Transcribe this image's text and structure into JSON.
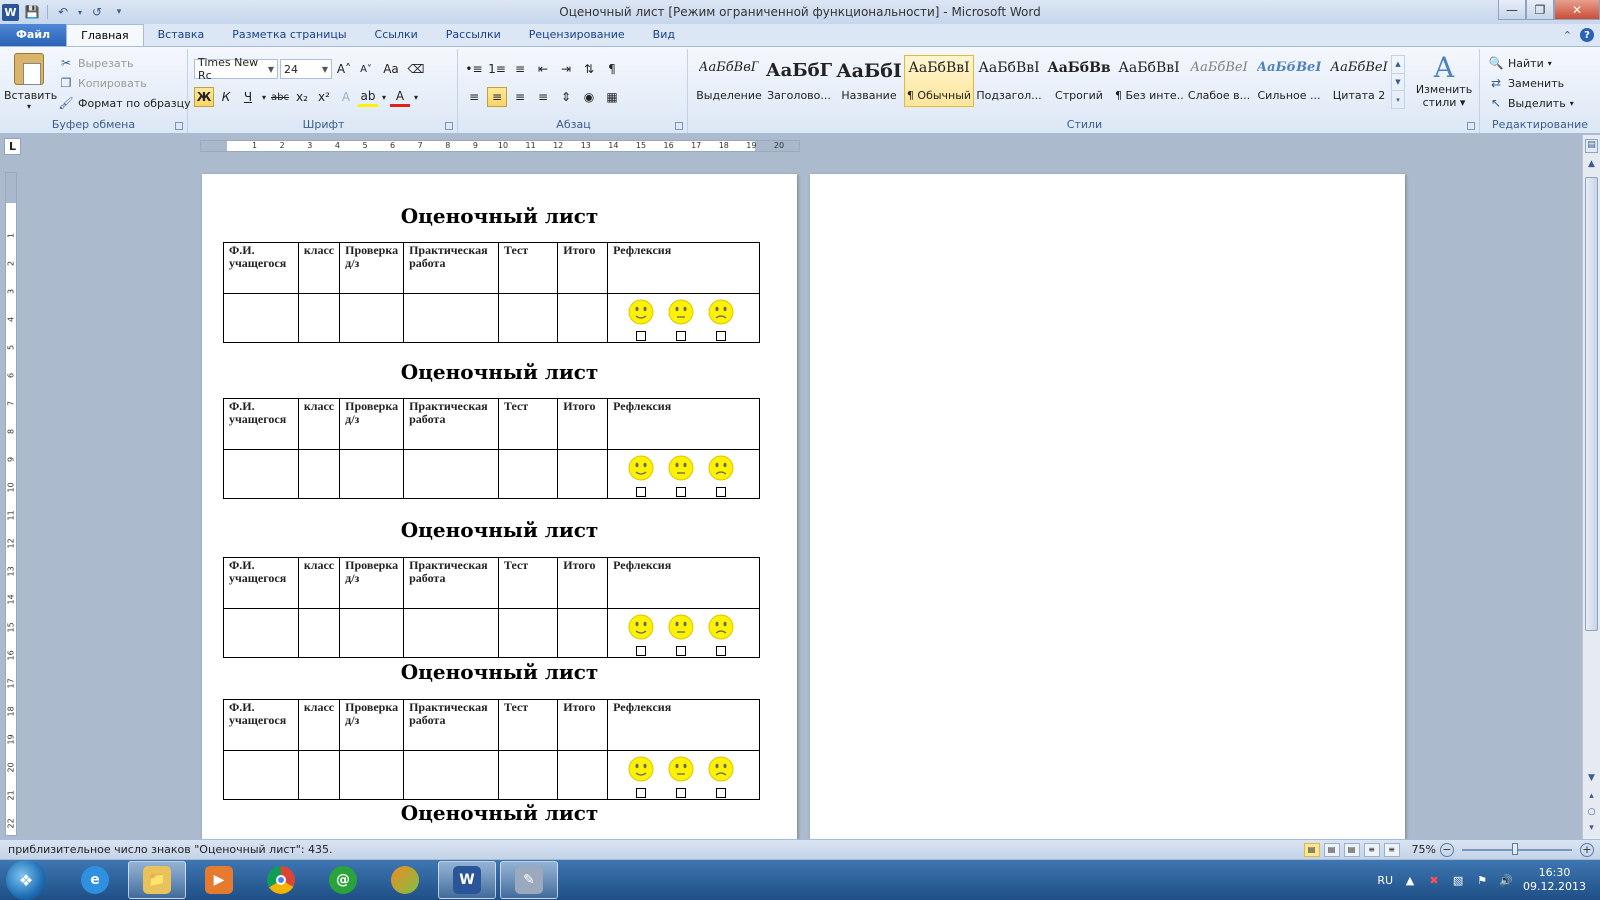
{
  "window": {
    "title": "Оценочный лист [Режим ограниченной функциональности]  -  Microsoft Word"
  },
  "tabs": [
    {
      "label": "Файл"
    },
    {
      "label": "Главная"
    },
    {
      "label": "Вставка"
    },
    {
      "label": "Разметка страницы"
    },
    {
      "label": "Ссылки"
    },
    {
      "label": "Рассылки"
    },
    {
      "label": "Рецензирование"
    },
    {
      "label": "Вид"
    }
  ],
  "clipboard": {
    "paste": "Вставить",
    "cut": "Вырезать",
    "copy": "Копировать",
    "format_painter": "Формат по образцу",
    "label": "Буфер обмена"
  },
  "font": {
    "name": "Times New Rc",
    "size": "24",
    "label": "Шрифт",
    "grow_icon": "A˄",
    "shrink_icon": "A˅",
    "case_icon": "Aa",
    "bold": "Ж",
    "italic": "К",
    "underline": "Ч",
    "strike": "abc",
    "subscript": "x₂",
    "superscript": "x²"
  },
  "paragraph": {
    "label": "Абзац",
    "pilcrow": "¶"
  },
  "styles": {
    "label": "Стили",
    "items": [
      {
        "sample": "АаБбВвГ",
        "name": "Выделение"
      },
      {
        "sample": "АаБбГ",
        "name": "Заголово..."
      },
      {
        "sample": "АаБбI",
        "name": "Название"
      },
      {
        "sample": "АаБбВвI",
        "name": "¶ Обычный"
      },
      {
        "sample": "АаБбВвI",
        "name": "Подзагол..."
      },
      {
        "sample": "АаБбВв",
        "name": "Строгий"
      },
      {
        "sample": "АаБбВвI",
        "name": "¶ Без инте..."
      },
      {
        "sample": "АаБбВеI",
        "name": "Слабое в..."
      },
      {
        "sample": "АаБбВеI",
        "name": "Сильное ..."
      },
      {
        "sample": "АаБбВеI",
        "name": "Цитата 2"
      }
    ],
    "change_styles_line1": "Изменить",
    "change_styles_line2": "стили ▾"
  },
  "editing": {
    "label": "Редактирование",
    "find": "Найти",
    "replace": "Заменить",
    "select": "Выделить"
  },
  "ruler": {
    "corner": "L",
    "ticks": [
      "1",
      "2",
      "3",
      "4",
      "5",
      "6",
      "7",
      "8",
      "9",
      "10",
      "11",
      "12",
      "13",
      "14",
      "15",
      "16",
      "17",
      "18",
      "19",
      "20"
    ],
    "vticks": [
      "1",
      "2",
      "3",
      "4",
      "5",
      "6",
      "7",
      "8",
      "9",
      "10",
      "11",
      "12",
      "13",
      "14",
      "15",
      "16",
      "17",
      "18",
      "19",
      "20",
      "21",
      "22"
    ]
  },
  "document": {
    "title": "Оценочный лист",
    "headers": [
      "Ф.И. учащегося",
      "класс",
      "Проверка д/з",
      "Практическая работа",
      "Тест",
      "Итого",
      "Рефлексия"
    ],
    "smileys": [
      "happy",
      "neutral",
      "sad"
    ],
    "smiley_color": "#FFF200"
  },
  "status": {
    "text": "приблизительное число знаков \"Оценочный лист\": 435.",
    "zoom": "75%"
  },
  "taskbar": {
    "language": "RU",
    "time": "16:30",
    "date": "09.12.2013"
  }
}
